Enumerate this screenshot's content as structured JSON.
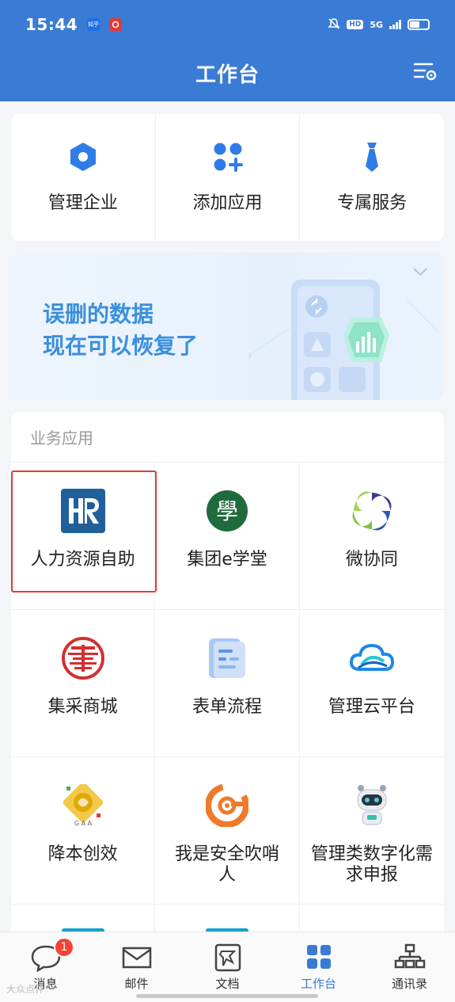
{
  "status_bar": {
    "time": "15:44",
    "notif_icons": [
      "zhihu-icon",
      "unionpay-icon"
    ],
    "zhihu_label": "知乎",
    "hd_label": "HD",
    "network_label": "5G"
  },
  "header": {
    "title": "工作台",
    "bg_color": "#3a7bd5"
  },
  "quick_actions": [
    {
      "label": "管理企业",
      "icon": "hexagon-icon"
    },
    {
      "label": "添加应用",
      "icon": "add-apps-icon"
    },
    {
      "label": "专属服务",
      "icon": "necktie-icon"
    }
  ],
  "banner": {
    "line1": "误删的数据",
    "line2": "现在可以恢复了"
  },
  "apps_section": {
    "title": "业务应用",
    "apps": [
      {
        "label": "人力资源自助",
        "icon": "hr-icon"
      },
      {
        "label": "集团e学堂",
        "icon": "xue-icon"
      },
      {
        "label": "微协同",
        "icon": "swirl-icon"
      },
      {
        "label": "集采商城",
        "icon": "shop-seal-icon"
      },
      {
        "label": "表单流程",
        "icon": "form-icon"
      },
      {
        "label": "管理云平台",
        "icon": "cloud-icon"
      },
      {
        "label": "降本创效",
        "icon": "gaa-icon"
      },
      {
        "label": "我是安全吹哨人",
        "icon": "whistle-icon"
      },
      {
        "label": "管理类数字化需求申报",
        "icon": "robot-icon"
      }
    ]
  },
  "bottom_nav": [
    {
      "label": "消息",
      "icon": "message-icon",
      "badge": "1"
    },
    {
      "label": "邮件",
      "icon": "mail-icon"
    },
    {
      "label": "文档",
      "icon": "document-icon"
    },
    {
      "label": "工作台",
      "icon": "workbench-icon",
      "active": true
    },
    {
      "label": "通讯录",
      "icon": "contacts-icon"
    }
  ],
  "watermark": "大众点评"
}
